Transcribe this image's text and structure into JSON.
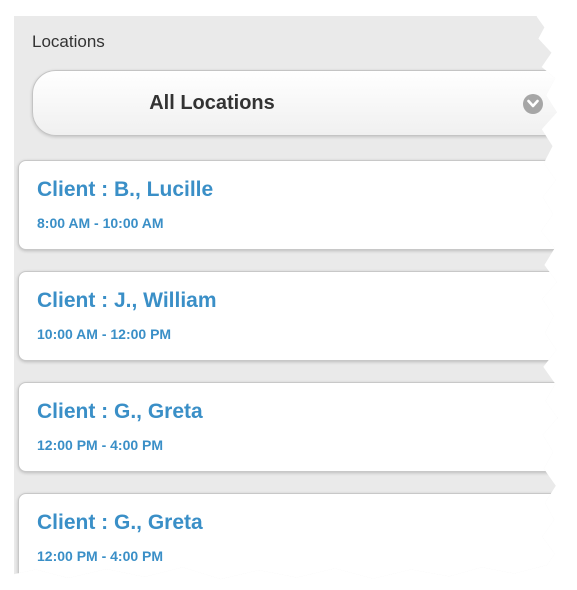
{
  "filter": {
    "label": "Locations",
    "selected": "All Locations",
    "icon": "chevron-down-icon"
  },
  "appointments": [
    {
      "title": "Client : B., Lucille",
      "time": "8:00 AM - 10:00 AM"
    },
    {
      "title": "Client : J., William",
      "time": "10:00 AM - 12:00 PM"
    },
    {
      "title": "Client : G., Greta",
      "time": "12:00 PM - 4:00 PM"
    },
    {
      "title": "Client : G., Greta",
      "time": "12:00 PM - 4:00 PM"
    }
  ],
  "colors": {
    "panel_bg": "#eaeaea",
    "link_blue": "#3a8fc7",
    "text_dark": "#333333",
    "icon_grey": "#a6a6a6"
  }
}
